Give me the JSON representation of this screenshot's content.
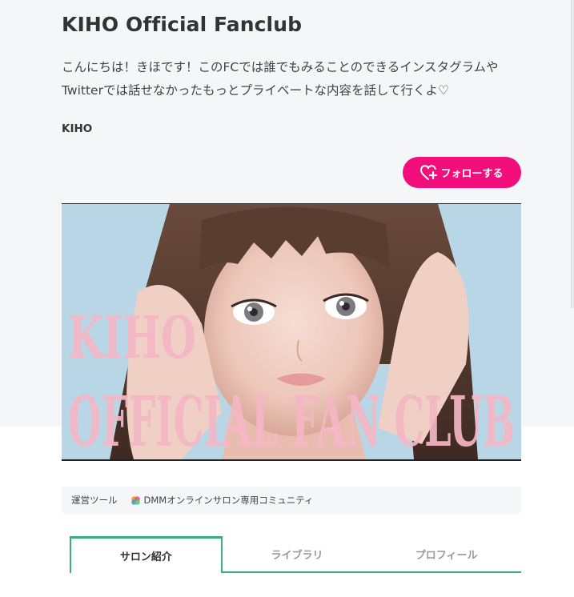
{
  "salon": {
    "title": "KIHO Official Fanclub",
    "description": "こんにちは！きほです！このFCでは誰でもみることのできるインスタグラムやTwitterでは話せなかったもっとプライベートな内容を話して行くよ♡",
    "owner": "KIHO"
  },
  "follow_button": {
    "label": "フォローする",
    "icon": "heart-plus-icon",
    "color": "#f20f7c"
  },
  "banner": {
    "line1": "KIHO",
    "line2": "OFFICIAL FAN CLUB",
    "text_color": "#f4b6c4",
    "background": "#b9d6e6"
  },
  "tools": {
    "label": "運営ツール",
    "service_icon": "dmm-logo-icon",
    "service_name": "DMMオンラインサロン専用コミュニティ"
  },
  "tabs": [
    {
      "label": "サロン紹介",
      "active": true
    },
    {
      "label": "ライブラリ",
      "active": false
    },
    {
      "label": "プロフィール",
      "active": false
    }
  ],
  "colors": {
    "accent_green": "#35b07a",
    "page_bg": "#f5f6f8"
  }
}
